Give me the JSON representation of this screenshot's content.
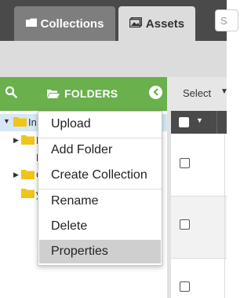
{
  "tabs": [
    {
      "label": "Collections",
      "icon": "folder-icon",
      "active": false
    },
    {
      "label": "Assets",
      "icon": "images-icon",
      "active": true
    }
  ],
  "search": {
    "placeholder": "S"
  },
  "folders_panel": {
    "title": "FOLDERS",
    "tree": [
      {
        "label": "In",
        "expanded": true,
        "selected": true
      },
      {
        "label": "F",
        "expanded": false
      },
      {
        "label": "F",
        "expanded": null
      },
      {
        "label": "C",
        "expanded": false
      },
      {
        "label": "y",
        "expanded": null
      }
    ]
  },
  "toolbar": {
    "select_label": "Select"
  },
  "context_menu": {
    "items": [
      {
        "label": "Upload"
      },
      {
        "label": "Add Folder"
      },
      {
        "label": "Create Collection"
      },
      {
        "label": "Rename"
      },
      {
        "label": "Delete"
      },
      {
        "label": "Properties",
        "highlighted": true
      }
    ]
  },
  "colors": {
    "header_dark": "#4a4a4a",
    "folders_green": "#6ab04c",
    "folder_yellow": "#f0c419",
    "selected_row": "#d6e8f5",
    "menu_highlight": "#cfcfcf"
  }
}
